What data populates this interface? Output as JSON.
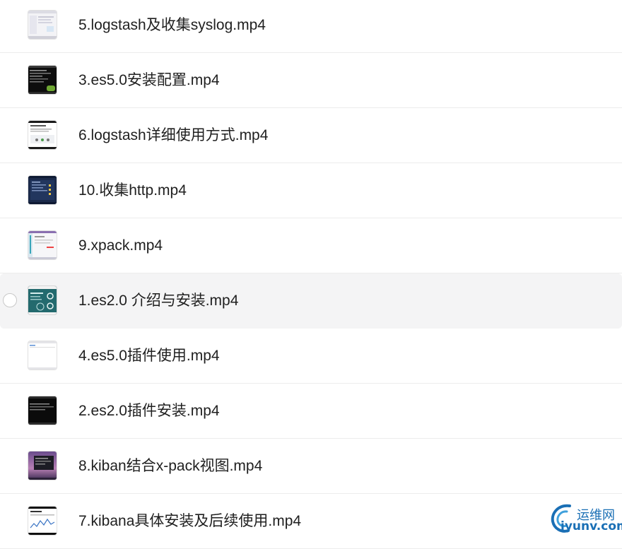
{
  "files": [
    {
      "name": "5.logstash及收集syslog.mp4",
      "thumb": "light-ui"
    },
    {
      "name": "3.es5.0安装配置.mp4",
      "thumb": "dark-terminal"
    },
    {
      "name": "6.logstash详细使用方式.mp4",
      "thumb": "document"
    },
    {
      "name": "10.收集http.mp4",
      "thumb": "dark-dashboard"
    },
    {
      "name": "9.xpack.mp4",
      "thumb": "light-ui-2"
    },
    {
      "name": "1.es2.0 介绍与安装.mp4",
      "thumb": "teal-slide",
      "hovered": true
    },
    {
      "name": "4.es5.0插件使用.mp4",
      "thumb": "blank-window"
    },
    {
      "name": "2.es2.0插件安装.mp4",
      "thumb": "dark-terminal-2"
    },
    {
      "name": "8.kiban结合x-pack视图.mp4",
      "thumb": "purple-desktop"
    },
    {
      "name": "7.kibana具体安装及后续使用.mp4",
      "thumb": "chart-doc"
    }
  ],
  "watermark": {
    "top": "运维网",
    "bottom": "iyunv.com"
  },
  "colors": {
    "row_hover": "#f4f4f5",
    "divider": "#ececec",
    "text": "#1f1f1f",
    "watermark": "#1a6fb5"
  }
}
